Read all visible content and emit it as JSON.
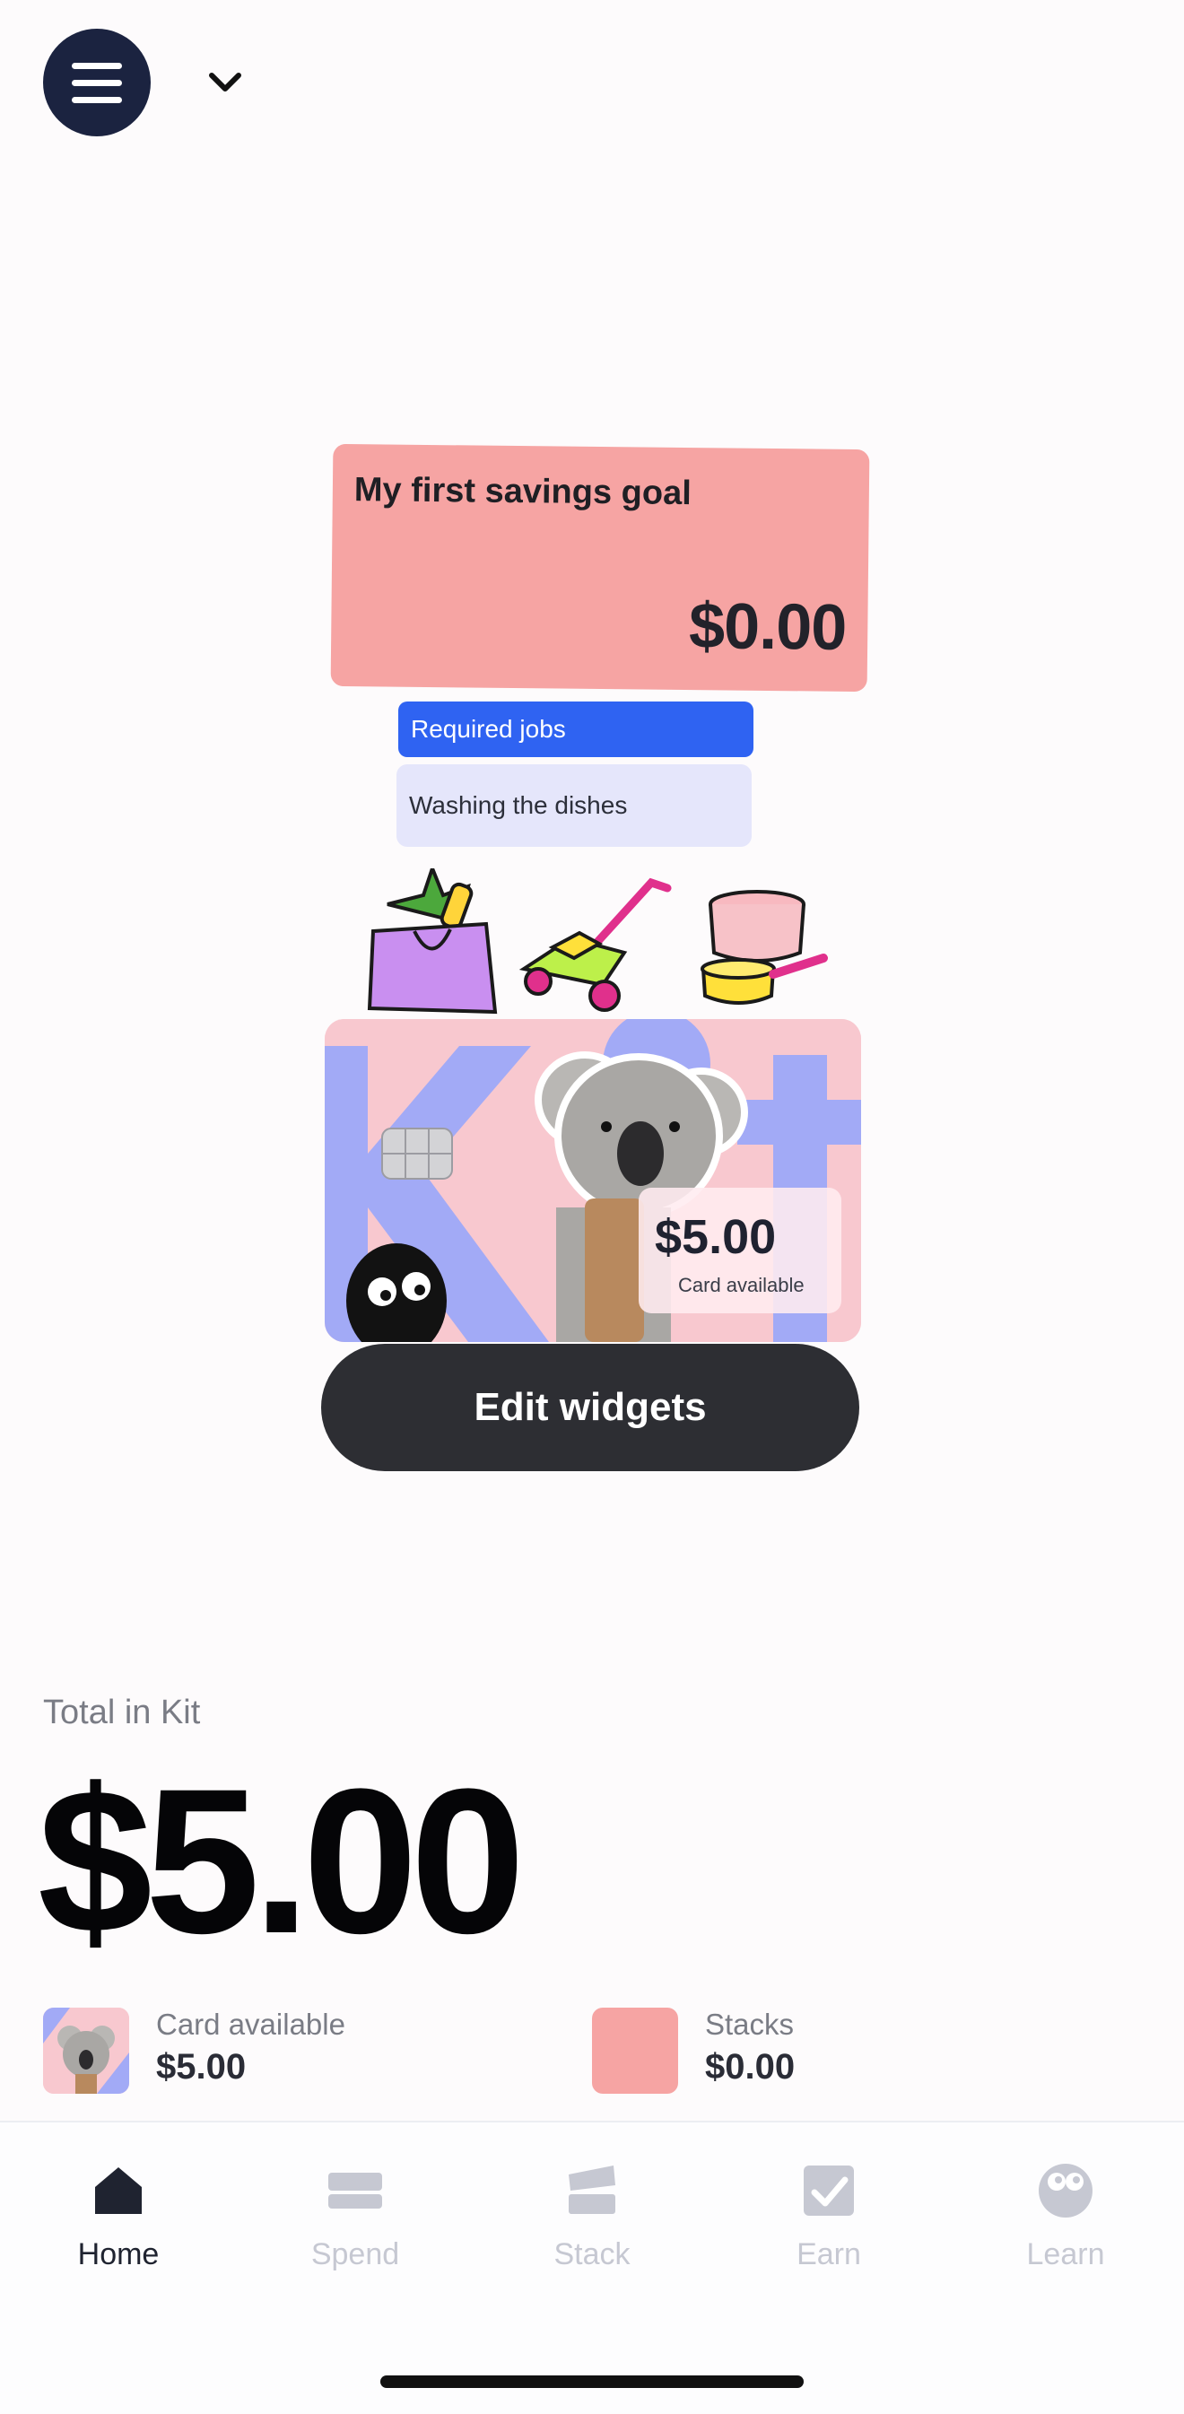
{
  "header": {
    "menu_icon": "hamburger-menu-icon",
    "dropdown_icon": "chevron-down-icon"
  },
  "widgets": {
    "savings_goal": {
      "title": "My first savings goal",
      "amount": "$0.00"
    },
    "jobs": {
      "header": "Required jobs",
      "item": "Washing the dishes"
    },
    "stickers": [
      "grocery-bag-icon",
      "lawn-mower-icon",
      "cooking-pots-icon"
    ],
    "card": {
      "amount": "$5.00",
      "caption": "Card available",
      "image": "koala-card-image"
    },
    "edit_button": "Edit widgets"
  },
  "summary": {
    "total_label": "Total in Kit",
    "total_amount": "$5.00",
    "card_available_label": "Card available",
    "card_available_value": "$5.00",
    "stacks_label": "Stacks",
    "stacks_value": "$0.00"
  },
  "tabs": [
    {
      "label": "Home",
      "icon": "house-icon",
      "active": true
    },
    {
      "label": "Spend",
      "icon": "card-icon",
      "active": false
    },
    {
      "label": "Stack",
      "icon": "stack-icon",
      "active": false
    },
    {
      "label": "Earn",
      "icon": "checkbox-icon",
      "active": false
    },
    {
      "label": "Learn",
      "icon": "eyes-icon",
      "active": false
    }
  ],
  "colors": {
    "active_tab": "#1f2330",
    "inactive_tab": "#c6c8d2",
    "accent_blue": "#2f63f2",
    "pink": "#f6a4a3",
    "dark_button": "#2d2e33"
  }
}
